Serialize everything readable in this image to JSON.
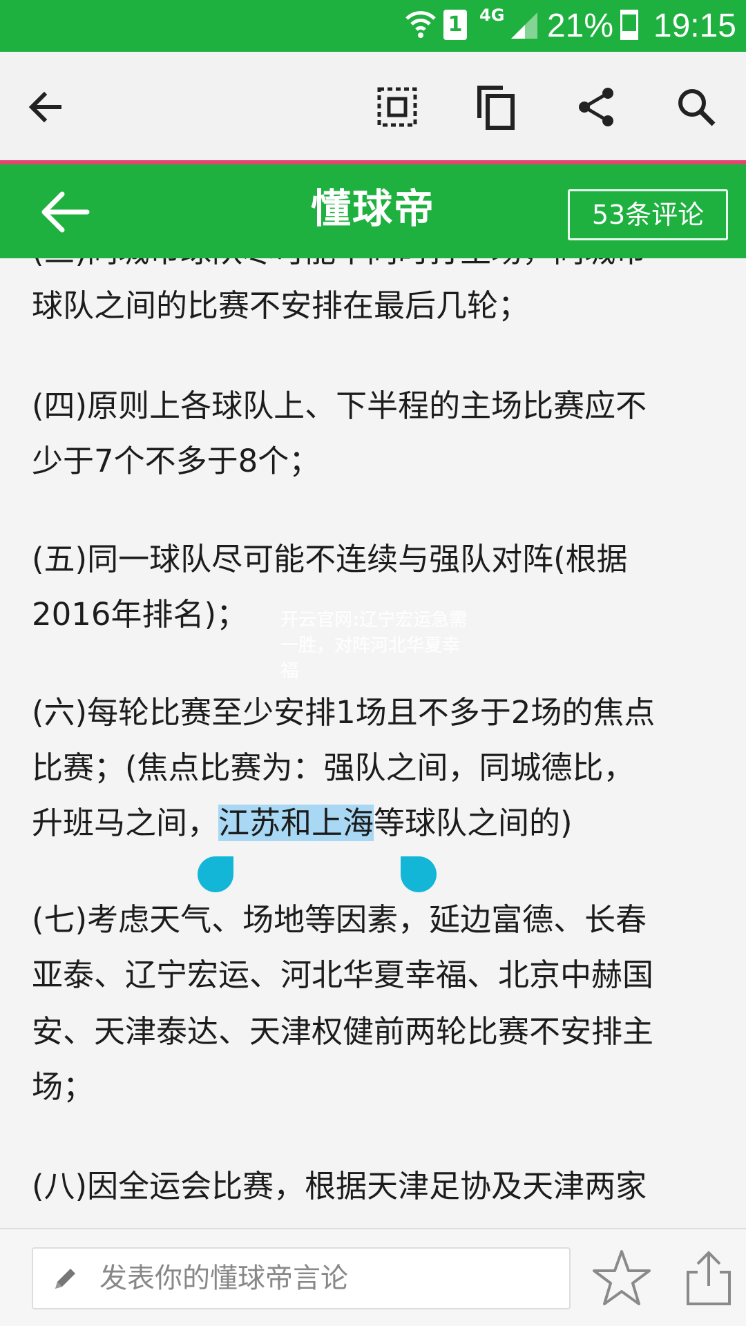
{
  "status_bar": {
    "network": "4G",
    "sim_slot": "1",
    "battery_percent": "21%",
    "time": "19:15",
    "background_color": "#1fb13f"
  },
  "action_bar": {
    "accent_color": "#e2456f",
    "icons": [
      "back-arrow-icon",
      "select-all-icon",
      "copy-icon",
      "share-icon",
      "search-icon"
    ]
  },
  "header": {
    "title": "懂球帝",
    "comments_label": "53条评论",
    "background_color": "#1fb13f"
  },
  "article": {
    "lines": [
      "(三)同城市球队尽可能不同时打主场，同城市",
      "球队之间的比赛不安排在最后几轮；",
      "(四)原则上各球队上、下半程的主场比赛应不",
      "少于7个不多于8个；",
      "(五)同一球队尽可能不连续与强队对阵(根据",
      "2016年排名)；",
      "(六)每轮比赛至少安排1场且不多于2场的焦点",
      "比赛；(焦点比赛为：强队之间，同城德比，",
      "升班马之间，",
      "江苏和上海",
      "等球队之间的)",
      "(七)考虑天气、场地等因素，延边富德、长春",
      "亚泰、辽宁宏运、河北华夏幸福、北京中赫国",
      "安、天津泰达、天津权健前两轮比赛不安排主",
      "场；",
      "(八)因全运会比赛，根据天津足协及天津两家"
    ],
    "highlight_color": "#a8d8f3",
    "handle_color": "#13b6d6"
  },
  "watermark": {
    "text": "开云官网:辽宁宏运急需一胜，对阵河北华夏幸福"
  },
  "bottom_bar": {
    "input_placeholder": "发表你的懂球帝言论",
    "icons": [
      "pencil-icon",
      "star-icon",
      "share-upload-icon"
    ]
  }
}
